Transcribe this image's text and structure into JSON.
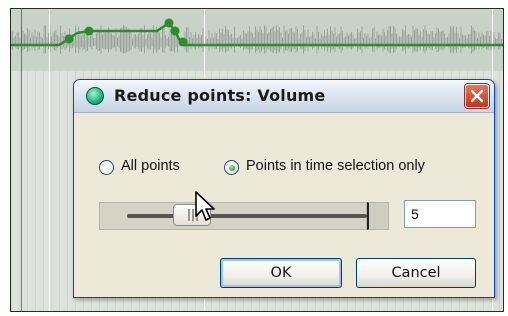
{
  "dialog": {
    "title": "Reduce points: Volume",
    "close_icon": "close-x-icon",
    "app_icon": "reaper-app-icon",
    "options": [
      {
        "label": "All points",
        "selected": false
      },
      {
        "label": "Points in time selection only",
        "selected": true
      }
    ],
    "slider": {
      "value_fraction": 0.32
    },
    "value_input": "5",
    "ok_label": "OK",
    "cancel_label": "Cancel"
  },
  "colors": {
    "envelope": "#2e8b2e",
    "title_bar": "#d6e0ee",
    "close_button": "#d2482f",
    "dialog_face": "#ece9d8"
  }
}
